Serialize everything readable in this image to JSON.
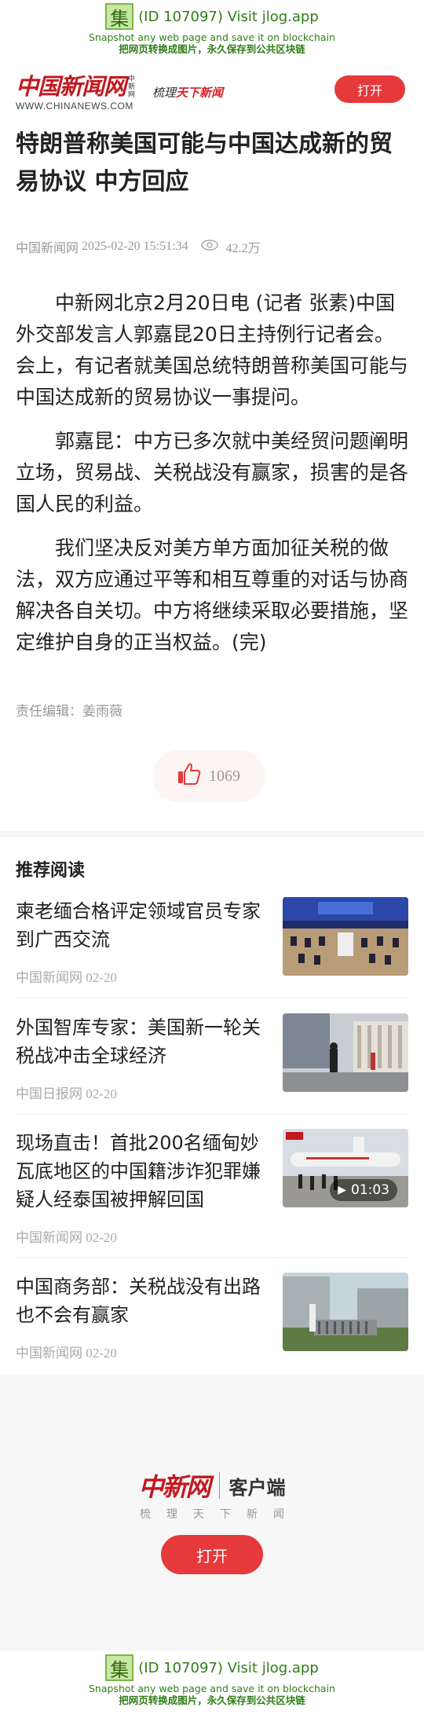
{
  "snapshot": {
    "logo_char": "集",
    "line1": "(ID 107097) Visit jlog.app",
    "line2": "Snapshot any web page and save it on blockchain",
    "line3": "把网页转换成图片，永久保存到公共区块链"
  },
  "header": {
    "brand_name": "中国新闻网",
    "brand_sub": "中新网",
    "brand_url": "WWW.CHINANEWS.COM",
    "slogan_a": "梳理",
    "slogan_b": "天下新闻",
    "open_label": "打开"
  },
  "article": {
    "title": "特朗普称美国可能与中国达成新的贸易协议 中方回应",
    "source": "中国新闻网",
    "datetime": "2025-02-20 15:51:34",
    "views": "42.2万",
    "paragraphs": [
      "中新网北京2月20日电 (记者 张素)中国外交部发言人郭嘉昆20日主持例行记者会。会上，有记者就美国总统特朗普称美国可能与中国达成新的贸易协议一事提问。",
      "郭嘉昆：中方已多次就中美经贸问题阐明立场，贸易战、关税战没有赢家，损害的是各国人民的利益。",
      "我们坚决反对美方单方面加征关税的做法，双方应通过平等和相互尊重的对话与协商解决各自关切。中方将继续采取必要措施，坚定维护自身的正当权益。(完)"
    ],
    "editor": "责任编辑：姜雨薇",
    "likes": "1069"
  },
  "recommend": {
    "heading": "推荐阅读",
    "items": [
      {
        "title": "柬老缅合格评定领域官员专家到广西交流",
        "source": "中国新闻网 02-20",
        "thumb": "conference-photo"
      },
      {
        "title": "外国智库专家：美国新一轮关税战冲击全球经济",
        "source": "中国日报网 02-20",
        "thumb": "street-photo"
      },
      {
        "title": "现场直击！首批200名缅甸妙瓦底地区的中国籍涉诈犯罪嫌疑人经泰国被押解回国",
        "source": "中国新闻网 02-20",
        "thumb": "airplane-video",
        "duration": "01:03"
      },
      {
        "title": "中国商务部：关税战没有出路也不会有赢家",
        "source": "中国新闻网 02-20",
        "thumb": "building-photo"
      }
    ]
  },
  "footer": {
    "brand": "中新网",
    "client": "客户端",
    "slogan": "梳理天下新闻",
    "open_label": "打开"
  },
  "colors": {
    "brand_red": "#c3191f",
    "button_red": "#e5393c",
    "snapshot_green": "#2f7d18"
  }
}
